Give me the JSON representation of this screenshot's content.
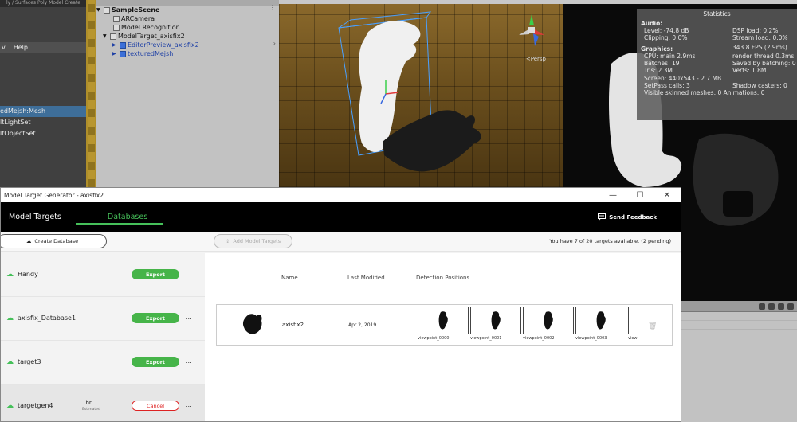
{
  "unity": {
    "left_topstrip": "ly / Surfaces     Poly Model   Create",
    "left_menu": [
      "v",
      "Help"
    ],
    "left_items": [
      "edMejsh:Mesh",
      "ltLightSet",
      "ltObjectSet"
    ],
    "hierarchy": [
      {
        "label": "SampleScene",
        "indent": 0,
        "arrow": "▼",
        "bold": true,
        "blue": false
      },
      {
        "label": "ARCamera",
        "indent": 12,
        "arrow": "",
        "bold": false,
        "blue": false
      },
      {
        "label": "Model Recognition",
        "indent": 12,
        "arrow": "",
        "bold": false,
        "blue": false
      },
      {
        "label": "ModelTarget_axisfix2",
        "indent": 8,
        "arrow": "▼",
        "bold": false,
        "blue": false
      },
      {
        "label": "EditorPreview_axisfix2",
        "indent": 20,
        "arrow": "▶",
        "bold": false,
        "blue": true
      },
      {
        "label": "texturedMejsh",
        "indent": 20,
        "arrow": "▶",
        "bold": false,
        "blue": true
      }
    ],
    "scene_persp": "<Persp",
    "stats": {
      "title": "Statistics",
      "audio_label": "Audio:",
      "audio_rows": [
        [
          "Level: -74.8 dB",
          "DSP load: 0.2%"
        ],
        [
          "Clipping: 0.0%",
          "Stream load: 0.0%"
        ]
      ],
      "graphics_label": "Graphics:",
      "fps": "343.8 FPS (2.9ms)",
      "graphics_rows": [
        [
          "CPU: main 2.9ms",
          "render thread 0.3ms"
        ],
        [
          "Batches: 19",
          "Saved by batching: 0"
        ],
        [
          "Tris: 2.3M",
          "Verts: 1.8M"
        ]
      ],
      "screen": "Screen: 440x543 - 2.7 MB",
      "setpass_rows": [
        [
          "SetPass calls: 3",
          "Shadow casters: 0"
        ]
      ],
      "skinned": "Visible skinned meshes: 0  Animations: 0"
    }
  },
  "window": {
    "title": "Model Target Generator - axisfix2",
    "minimize": "—",
    "maximize": "☐",
    "close": "✕"
  },
  "tabs": [
    "Model Targets",
    "Databases"
  ],
  "feedback_label": "Send Feedback",
  "toolbar": {
    "create_db": "Create Database",
    "add_mt": "Add Model Targets",
    "availability": "You have 7 of 20 targets available. (2 pending)"
  },
  "databases": [
    {
      "name": "Handy",
      "action": "Export",
      "eta": "",
      "eta_sub": ""
    },
    {
      "name": "axisfix_Database1",
      "action": "Export",
      "eta": "",
      "eta_sub": ""
    },
    {
      "name": "target3",
      "action": "Export",
      "eta": "",
      "eta_sub": ""
    },
    {
      "name": "targetgen4",
      "action": "Cancel",
      "eta": "1hr",
      "eta_sub": "Estimated"
    }
  ],
  "more_label": "...",
  "table": {
    "headers": {
      "name": "Name",
      "modified": "Last Modified",
      "positions": "Detection Positions"
    },
    "row": {
      "name": "axisfix2",
      "date": "Apr 2, 2019",
      "viewpoints": [
        "viewpoint_0000",
        "viewpoint_0001",
        "viewpoint_0002",
        "viewpoint_0003",
        "view"
      ]
    }
  },
  "colors": {
    "accent_green": "#46c05a",
    "export_green": "#46b449",
    "cancel_red": "#dd2222",
    "selection_blue": "#3e6e99"
  }
}
